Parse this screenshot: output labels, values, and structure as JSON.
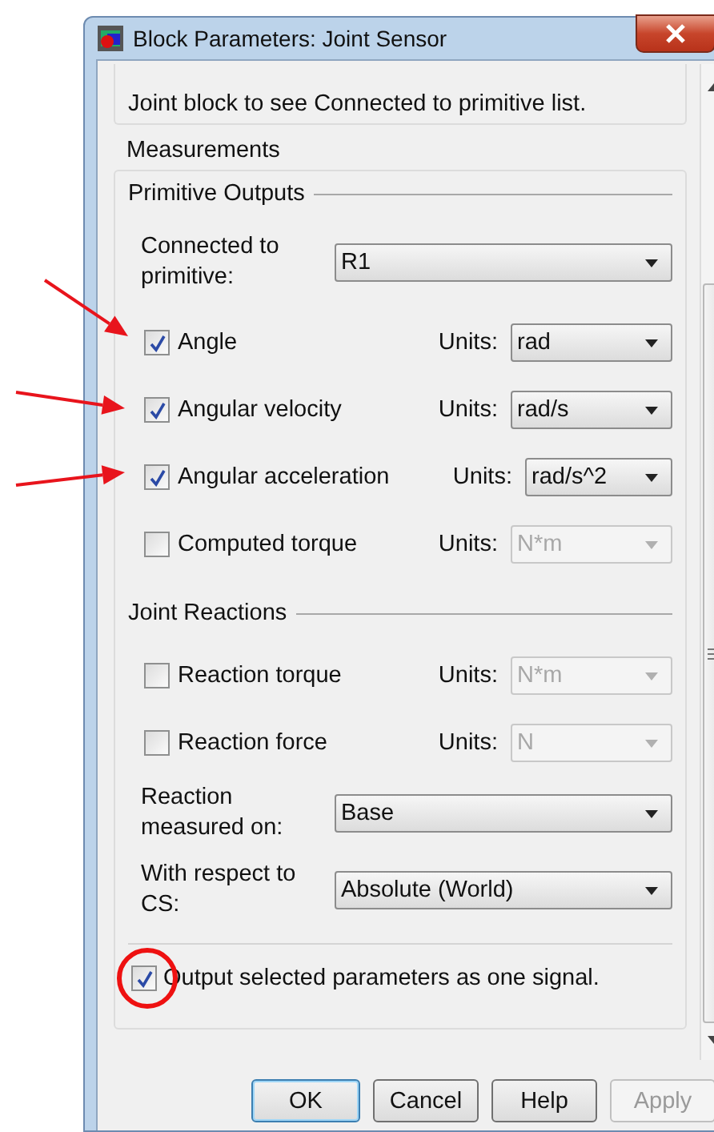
{
  "window": {
    "title": "Block Parameters: Joint Sensor"
  },
  "description": "Joint block to see Connected to primitive list.",
  "measurements": {
    "title": "Measurements",
    "primitive_outputs": {
      "title": "Primitive Outputs",
      "connected_to": {
        "label": "Connected to primitive:",
        "value": "R1"
      },
      "outputs": [
        {
          "label": "Angle",
          "checked": true,
          "units_label": "Units:",
          "units": "rad",
          "disabled": false,
          "highlighted": true
        },
        {
          "label": "Angular velocity",
          "checked": true,
          "units_label": "Units:",
          "units": "rad/s",
          "disabled": false,
          "highlighted": true
        },
        {
          "label": "Angular acceleration",
          "checked": true,
          "units_label": "Units:",
          "units": "rad/s^2",
          "disabled": false,
          "highlighted": true
        },
        {
          "label": "Computed torque",
          "checked": false,
          "units_label": "Units:",
          "units": "N*m",
          "disabled": true,
          "highlighted": false
        }
      ]
    },
    "joint_reactions": {
      "title": "Joint Reactions",
      "outputs": [
        {
          "label": "Reaction torque",
          "checked": false,
          "units_label": "Units:",
          "units": "N*m",
          "disabled": true,
          "highlighted": false
        },
        {
          "label": "Reaction force",
          "checked": false,
          "units_label": "Units:",
          "units": "N",
          "disabled": true,
          "highlighted": false
        }
      ],
      "measured_on": {
        "label": "Reaction measured on:",
        "value": "Base"
      },
      "with_respect_to": {
        "label": "With respect to CS:",
        "value": "Absolute (World)"
      }
    },
    "single_signal": {
      "label": "Output selected parameters as one signal.",
      "checked": true,
      "circled": true
    }
  },
  "buttons": [
    {
      "label": "OK",
      "default": true,
      "disabled": false
    },
    {
      "label": "Cancel",
      "default": false,
      "disabled": false
    },
    {
      "label": "Help",
      "default": false,
      "disabled": false
    },
    {
      "label": "Apply",
      "default": false,
      "disabled": true
    }
  ]
}
